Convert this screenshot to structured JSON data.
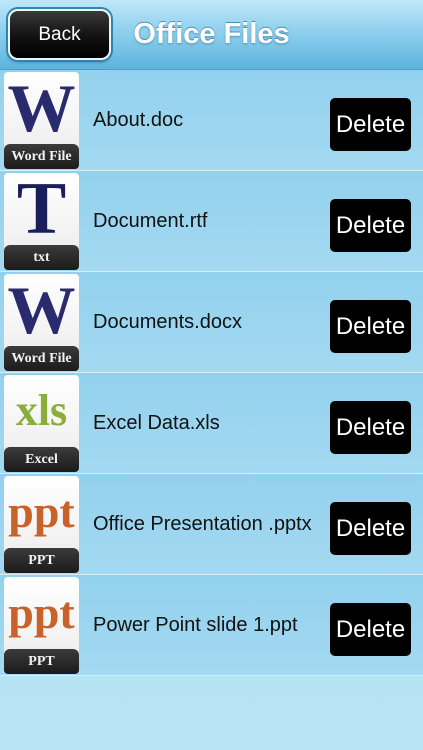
{
  "header": {
    "title": "Office Files",
    "back_label": "Back"
  },
  "files": [
    {
      "name": "About.doc",
      "icon": "word-file-icon",
      "glyph": "W",
      "tag": "Word File",
      "glyph_color": "#2a2a6e",
      "delete_label": "Delete"
    },
    {
      "name": "Document.rtf",
      "icon": "txt-file-icon",
      "glyph": "T",
      "tag": "txt",
      "glyph_color": "#1a1f5c",
      "delete_label": "Delete"
    },
    {
      "name": "Documents.docx",
      "icon": "word-file-icon",
      "glyph": "W",
      "tag": "Word File",
      "glyph_color": "#2a2a6e",
      "delete_label": "Delete"
    },
    {
      "name": "Excel Data.xls",
      "icon": "excel-file-icon",
      "glyph": "xls",
      "tag": "Excel",
      "glyph_color": "#8cad3a",
      "delete_label": "Delete"
    },
    {
      "name": "Office Presentation .pptx",
      "icon": "ppt-file-icon",
      "glyph": "ppt",
      "tag": "PPT",
      "glyph_color": "#c9622a",
      "delete_label": "Delete"
    },
    {
      "name": "Power Point slide 1.ppt",
      "icon": "ppt-file-icon",
      "glyph": "ppt",
      "tag": "PPT",
      "glyph_color": "#c9622a",
      "delete_label": "Delete"
    }
  ],
  "colors": {
    "navbar": "#5db4dd",
    "row_background": "#9fd5ef",
    "delete_button": "#000000"
  }
}
